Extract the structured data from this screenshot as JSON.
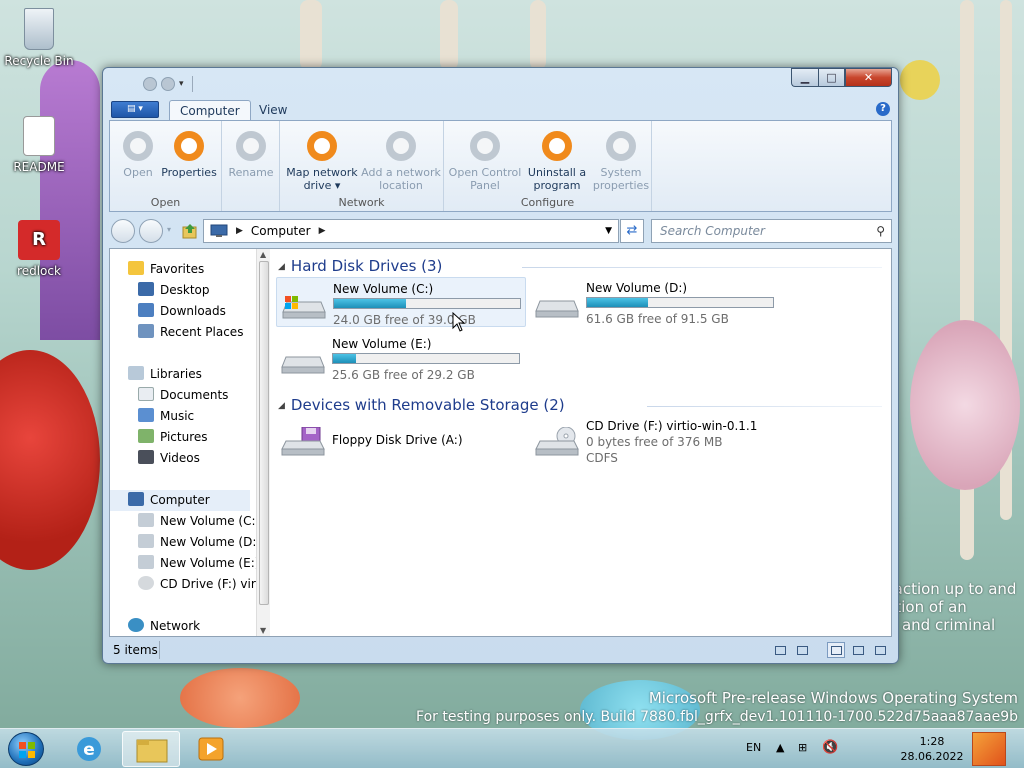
{
  "desktop": {
    "icons": [
      {
        "label": "Recycle Bin"
      },
      {
        "label": "README"
      },
      {
        "label": "redlock"
      }
    ],
    "watermark": {
      "line1": "Microsoft Pre-release Windows Operating System",
      "line2": "For testing purposes only. Build 7880.fbl_grfx_dev1.101110-1700.522d75aaa87aae9b"
    },
    "side_text": [
      "y action up to and",
      "ration of an",
      "vil and criminal"
    ]
  },
  "window": {
    "ribbon": {
      "tabs": [
        {
          "label": "Computer",
          "active": true
        },
        {
          "label": "View",
          "active": false
        }
      ],
      "groups": [
        {
          "label": "Open",
          "buttons": [
            {
              "label": "Open",
              "enabled": false
            },
            {
              "label": "Properties",
              "enabled": true
            }
          ]
        },
        {
          "label": "",
          "buttons": [
            {
              "label": "Rename",
              "enabled": false
            }
          ]
        },
        {
          "label": "Network",
          "buttons": [
            {
              "label": "Map network drive ▾",
              "enabled": true
            },
            {
              "label": "Add a network location",
              "enabled": false
            }
          ]
        },
        {
          "label": "Configure",
          "buttons": [
            {
              "label": "Open Control Panel",
              "enabled": false
            },
            {
              "label": "Uninstall a program",
              "enabled": true
            },
            {
              "label": "System properties",
              "enabled": false
            }
          ]
        }
      ]
    },
    "address": {
      "crumb": "Computer"
    },
    "search": {
      "placeholder": "Search Computer"
    },
    "nav": {
      "favorites": "Favorites",
      "desktop": "Desktop",
      "downloads": "Downloads",
      "recent": "Recent Places",
      "libraries": "Libraries",
      "documents": "Documents",
      "music": "Music",
      "pictures": "Pictures",
      "videos": "Videos",
      "computer": "Computer",
      "vol_c": "New Volume (C:)",
      "vol_d": "New Volume (D:)",
      "vol_e": "New Volume (E:)",
      "cd": "CD Drive (F:) virti",
      "network": "Network"
    },
    "groups": {
      "hdd": "Hard Disk Drives (3)",
      "removable": "Devices with Removable Storage (2)"
    },
    "drives": {
      "c": {
        "name": "New Volume (C:)",
        "free": "24.0 GB free of 39.0 GB",
        "used_fraction": 0.385
      },
      "d": {
        "name": "New Volume (D:)",
        "free": "61.6 GB free of 91.5 GB",
        "used_fraction": 0.327
      },
      "e": {
        "name": "New Volume (E:)",
        "free": "25.6 GB free of 29.2 GB",
        "used_fraction": 0.123
      },
      "a": {
        "name": "Floppy Disk Drive (A:)"
      },
      "f": {
        "name": "CD Drive (F:) virtio-win-0.1.1",
        "free": "0 bytes free of 376 MB",
        "fs": "CDFS"
      }
    },
    "status": {
      "count": "5 items"
    }
  },
  "taskbar": {
    "lang": "EN",
    "time": "1:28",
    "date": "28.06.2022"
  }
}
